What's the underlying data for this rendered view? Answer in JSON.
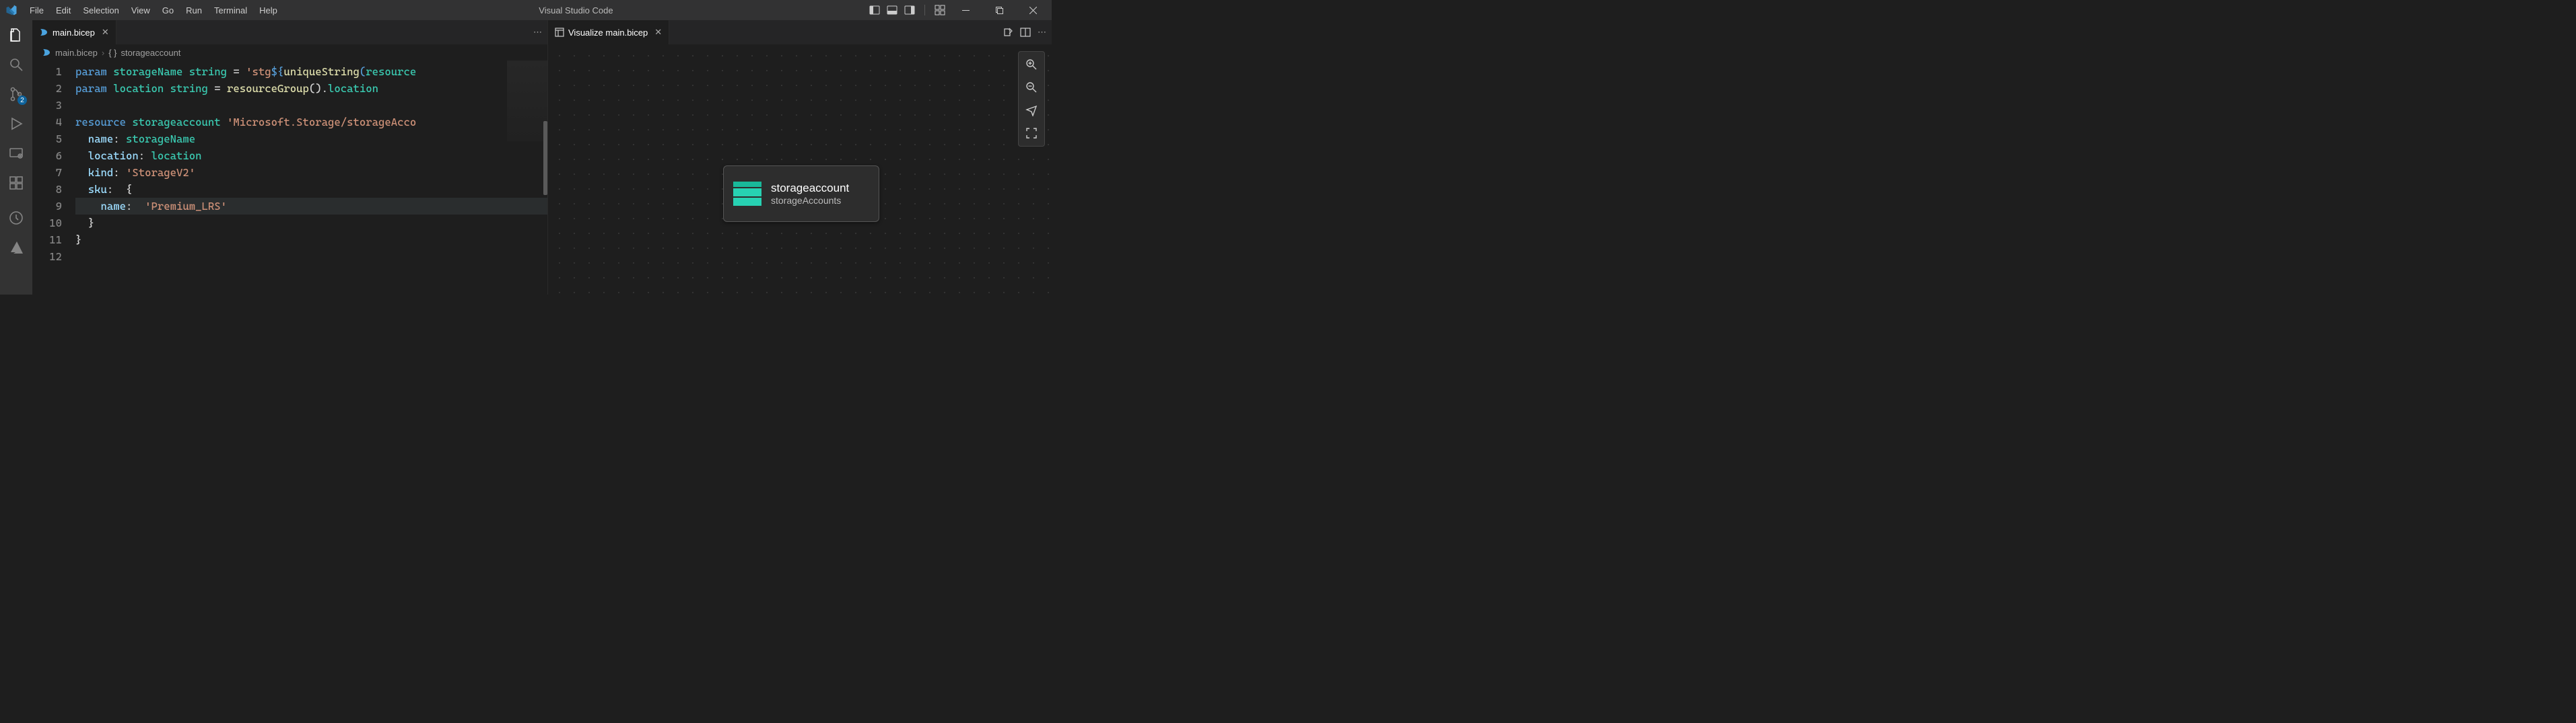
{
  "app_title": "Visual Studio Code",
  "menu": [
    "File",
    "Edit",
    "Selection",
    "View",
    "Go",
    "Run",
    "Terminal",
    "Help"
  ],
  "scm_badge": "2",
  "editor": {
    "tab_label": "main.bicep",
    "breadcrumb": {
      "file": "main.bicep",
      "symbol": "storageaccount"
    },
    "lines": [
      {
        "n": "1",
        "seg": [
          [
            "kw",
            "param "
          ],
          [
            "ident",
            "storageName "
          ],
          [
            "typ",
            "string "
          ],
          [
            "punc",
            "= "
          ],
          [
            "str",
            "'stg"
          ],
          [
            "interp",
            "${"
          ],
          [
            "fn",
            "uniqueString"
          ],
          [
            "interp",
            "("
          ],
          [
            "ident",
            "resource"
          ]
        ]
      },
      {
        "n": "2",
        "seg": [
          [
            "kw",
            "param "
          ],
          [
            "ident",
            "location "
          ],
          [
            "typ",
            "string "
          ],
          [
            "punc",
            "= "
          ],
          [
            "fn",
            "resourceGroup"
          ],
          [
            "punc",
            "()."
          ],
          [
            "ident",
            "location"
          ]
        ]
      },
      {
        "n": "3",
        "seg": []
      },
      {
        "n": "4",
        "seg": [
          [
            "kw",
            "resource "
          ],
          [
            "ident",
            "storageaccount "
          ],
          [
            "str",
            "'Microsoft.Storage/storageAcco"
          ]
        ]
      },
      {
        "n": "5",
        "seg": [
          [
            "punc",
            "  "
          ],
          [
            "prop",
            "name"
          ],
          [
            "punc",
            ": "
          ],
          [
            "ident",
            "storageName"
          ]
        ]
      },
      {
        "n": "6",
        "seg": [
          [
            "punc",
            "  "
          ],
          [
            "prop",
            "location"
          ],
          [
            "punc",
            ": "
          ],
          [
            "ident",
            "location"
          ]
        ]
      },
      {
        "n": "7",
        "seg": [
          [
            "punc",
            "  "
          ],
          [
            "prop",
            "kind"
          ],
          [
            "punc",
            ": "
          ],
          [
            "str",
            "'StorageV2'"
          ]
        ]
      },
      {
        "n": "8",
        "seg": [
          [
            "punc",
            "  "
          ],
          [
            "prop",
            "sku"
          ],
          [
            "punc",
            ":  {"
          ]
        ]
      },
      {
        "n": "9",
        "hl": true,
        "seg": [
          [
            "punc",
            "    "
          ],
          [
            "prop",
            "name"
          ],
          [
            "punc",
            ":  "
          ],
          [
            "str",
            "'Premium_LRS'"
          ]
        ]
      },
      {
        "n": "10",
        "seg": [
          [
            "punc",
            "  }"
          ]
        ]
      },
      {
        "n": "11",
        "seg": [
          [
            "punc",
            "}"
          ]
        ]
      },
      {
        "n": "12",
        "seg": []
      }
    ]
  },
  "visualizer": {
    "tab_label": "Visualize main.bicep",
    "node": {
      "title": "storageaccount",
      "subtitle": "storageAccounts"
    }
  }
}
